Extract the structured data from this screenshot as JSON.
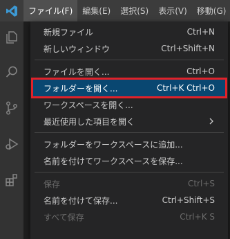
{
  "menubar": {
    "items": [
      {
        "label": "ファイル(F)"
      },
      {
        "label": "編集(E)"
      },
      {
        "label": "選択(S)"
      },
      {
        "label": "表示(V)"
      },
      {
        "label": "移動(G)"
      }
    ]
  },
  "activitybar": {
    "icons": [
      "explorer-icon",
      "search-icon",
      "source-control-icon",
      "run-debug-icon",
      "extensions-icon"
    ]
  },
  "file_menu": {
    "new_file": {
      "label": "新規ファイル",
      "shortcut": "Ctrl+N"
    },
    "new_window": {
      "label": "新しいウィンドウ",
      "shortcut": "Ctrl+Shift+N"
    },
    "open_file": {
      "label": "ファイルを開く...",
      "shortcut": "Ctrl+O"
    },
    "open_folder": {
      "label": "フォルダーを開く...",
      "shortcut": "Ctrl+K Ctrl+O"
    },
    "open_workspace": {
      "label": "ワークスペースを開く..."
    },
    "open_recent": {
      "label": "最近使用した項目を開く"
    },
    "add_folder_to_workspace": {
      "label": "フォルダーをワークスペースに追加..."
    },
    "save_workspace_as": {
      "label": "名前を付けてワークスペースを保存..."
    },
    "save": {
      "label": "保存",
      "shortcut": "Ctrl+S"
    },
    "save_as": {
      "label": "名前を付けて保存...",
      "shortcut": "Ctrl+Shift+S"
    },
    "save_all": {
      "label": "すべて保存",
      "shortcut": "Ctrl+K S"
    }
  },
  "colors": {
    "menubar_bg": "#3c3c3c",
    "menu_bg": "#252526",
    "highlight_bg": "#094771",
    "highlight_outline": "#e0222a",
    "vscode_blue": "#3c99d4"
  }
}
